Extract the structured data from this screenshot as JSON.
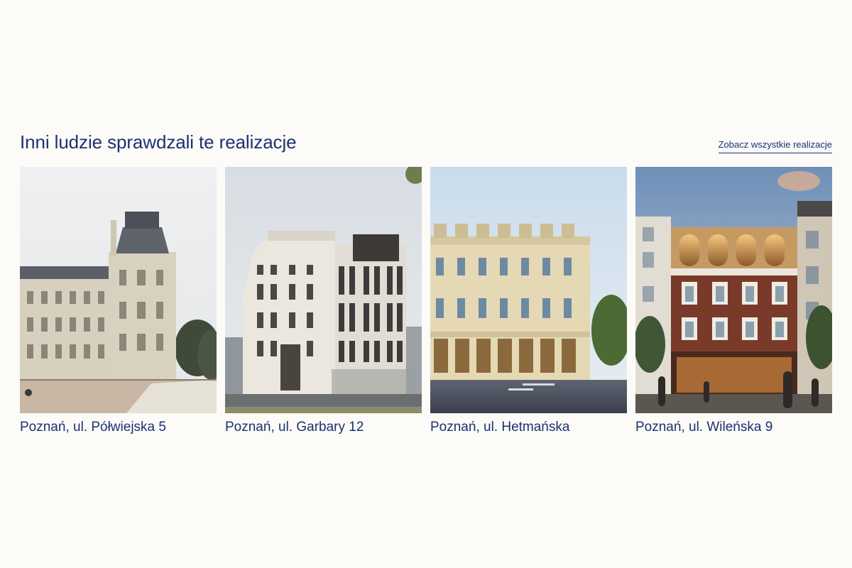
{
  "section": {
    "title": "Inni ludzie sprawdzali te realizacje",
    "see_all_label": "Zobacz wszystkie realizacje"
  },
  "cards": [
    {
      "caption": "Poznań, ul. Półwiejska 5"
    },
    {
      "caption": "Poznań, ul. Garbary 12"
    },
    {
      "caption": "Poznań, ul. Hetmańska"
    },
    {
      "caption": "Poznań, ul. Wileńska 9"
    }
  ],
  "colors": {
    "background": "#fcfbf8",
    "accent": "#1d3170"
  }
}
